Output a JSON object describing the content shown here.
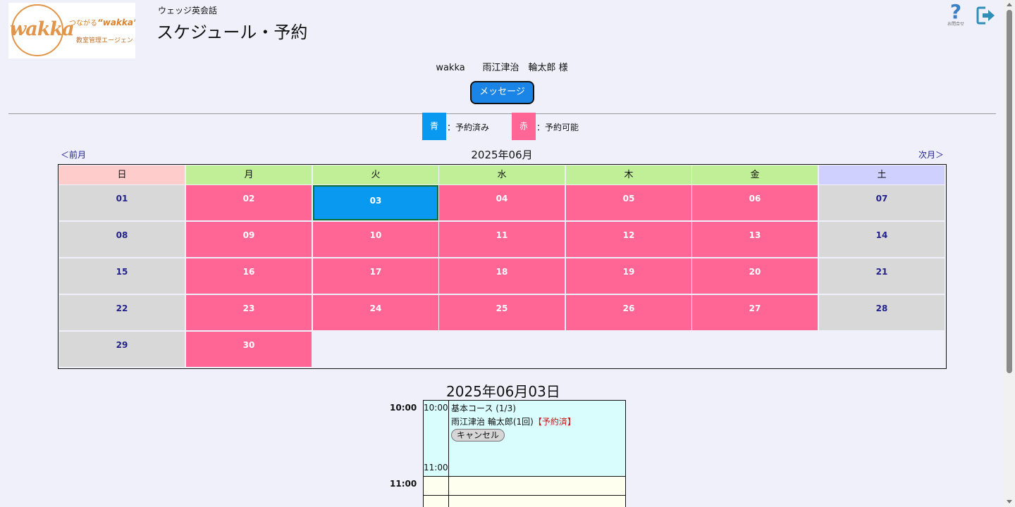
{
  "logo": {
    "word": "wakka",
    "tag_prefix": "つながる",
    "tag_word": "“wakka”",
    "sub": "教室管理エージェント"
  },
  "header": {
    "school": "ウェッジ英会話",
    "title": "スケジュール・予約"
  },
  "icons": {
    "help_label": "お問合せ",
    "help_glyph": "?"
  },
  "user": {
    "line": "wakka      雨江津治　輪太郎 様"
  },
  "message_button": "メッセージ",
  "legend": {
    "booked_box": "青",
    "booked_text": "：予約済み",
    "available_box": "赤",
    "available_text": "：予約可能",
    "colors": {
      "booked": "#0999f0",
      "available": "#ff6695"
    }
  },
  "calendar": {
    "prev": "＜前月",
    "next": "次月＞",
    "month_title": "2025年06月",
    "weekdays": [
      {
        "label": "日",
        "color": "#ffcccc"
      },
      {
        "label": "月",
        "color": "#c1ef97"
      },
      {
        "label": "火",
        "color": "#c1ef97"
      },
      {
        "label": "水",
        "color": "#c1ef97"
      },
      {
        "label": "木",
        "color": "#c1ef97"
      },
      {
        "label": "金",
        "color": "#c1ef97"
      },
      {
        "label": "土",
        "color": "#d0d0ff"
      }
    ],
    "weeks": [
      [
        {
          "d": "01",
          "s": "weekend"
        },
        {
          "d": "02",
          "s": "avail"
        },
        {
          "d": "03",
          "s": "booked"
        },
        {
          "d": "04",
          "s": "avail"
        },
        {
          "d": "05",
          "s": "avail"
        },
        {
          "d": "06",
          "s": "avail"
        },
        {
          "d": "07",
          "s": "weekend"
        }
      ],
      [
        {
          "d": "08",
          "s": "weekend"
        },
        {
          "d": "09",
          "s": "avail"
        },
        {
          "d": "10",
          "s": "avail"
        },
        {
          "d": "11",
          "s": "avail"
        },
        {
          "d": "12",
          "s": "avail"
        },
        {
          "d": "13",
          "s": "avail"
        },
        {
          "d": "14",
          "s": "weekend"
        }
      ],
      [
        {
          "d": "15",
          "s": "weekend"
        },
        {
          "d": "16",
          "s": "avail"
        },
        {
          "d": "17",
          "s": "avail"
        },
        {
          "d": "18",
          "s": "avail"
        },
        {
          "d": "19",
          "s": "avail"
        },
        {
          "d": "20",
          "s": "avail"
        },
        {
          "d": "21",
          "s": "weekend"
        }
      ],
      [
        {
          "d": "22",
          "s": "weekend"
        },
        {
          "d": "23",
          "s": "avail"
        },
        {
          "d": "24",
          "s": "avail"
        },
        {
          "d": "25",
          "s": "avail"
        },
        {
          "d": "26",
          "s": "avail"
        },
        {
          "d": "27",
          "s": "avail"
        },
        {
          "d": "28",
          "s": "weekend"
        }
      ],
      [
        {
          "d": "29",
          "s": "weekend"
        },
        {
          "d": "30",
          "s": "avail"
        }
      ]
    ]
  },
  "schedule": {
    "date_title": "2025年06月03日",
    "time_10": "10:00",
    "time_11": "11:00",
    "slot_start": "10:00",
    "slot_end": "11:00",
    "course": "基本コース (1/3)",
    "student": "雨江津治 輪太郎(1回)",
    "status": "【予約済】",
    "cancel": "キャンセル"
  }
}
